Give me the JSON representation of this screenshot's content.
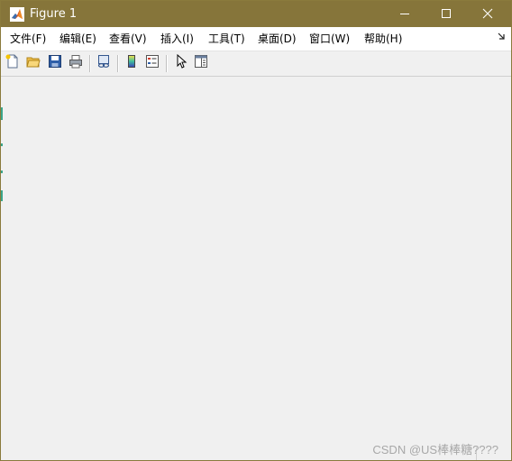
{
  "window": {
    "title": "Figure 1",
    "titlebar_color": "#86753a",
    "buttons": {
      "minimize_icon": "minimize-icon",
      "maximize_icon": "maximize-icon",
      "close_icon": "close-icon"
    }
  },
  "menubar": {
    "items": [
      {
        "label": "文件(F)"
      },
      {
        "label": "编辑(E)"
      },
      {
        "label": "查看(V)"
      },
      {
        "label": "插入(I)"
      },
      {
        "label": "工具(T)"
      },
      {
        "label": "桌面(D)"
      },
      {
        "label": "窗口(W)"
      },
      {
        "label": "帮助(H)"
      }
    ],
    "overflow_icon": "chevron-overflow-icon"
  },
  "toolbar": {
    "items": [
      "new-figure-icon",
      "open-file-icon",
      "save-icon",
      "print-icon",
      "link-plot-icon",
      "insert-colorbar-icon",
      "insert-legend-icon",
      "edit-plot-pointer-icon",
      "property-inspector-icon"
    ]
  },
  "watermark": "CSDN @US棒棒糖????"
}
